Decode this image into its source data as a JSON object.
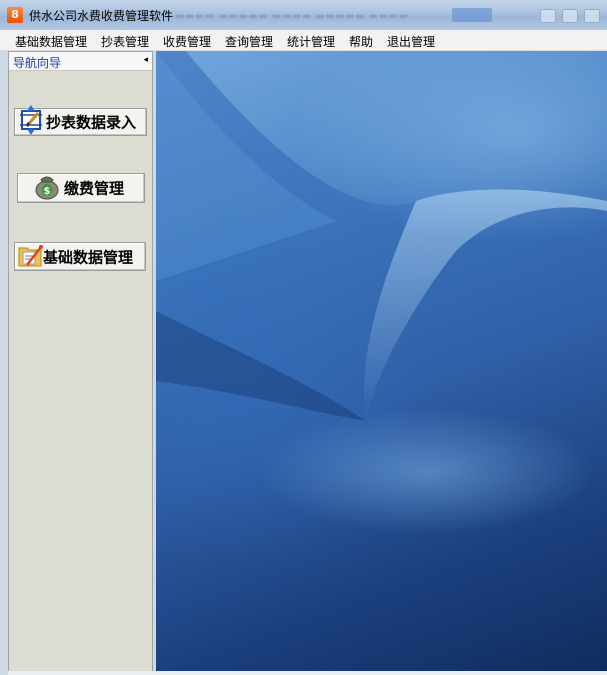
{
  "window": {
    "title": "供水公司水费收费管理软件",
    "icon_glyph": "8",
    "icon_color": "#e8500c"
  },
  "menubar": {
    "items": [
      "基础数据管理",
      "抄表管理",
      "收费管理",
      "查询管理",
      "统计管理",
      "帮助",
      "退出管理"
    ]
  },
  "nav": {
    "title": "导航向导",
    "collapse_glyph": "◂",
    "buttons": [
      {
        "label": "抄表数据录入",
        "icon": "meter-reading-icon"
      },
      {
        "label": "缴费管理",
        "icon": "money-bag-icon"
      },
      {
        "label": "基础数据管理",
        "icon": "folder-edit-icon"
      }
    ],
    "title_color": "#1a3cae"
  },
  "desktop": {
    "wallpaper": "blue-abstract-wallpaper",
    "accent": "#2f5fa6"
  }
}
